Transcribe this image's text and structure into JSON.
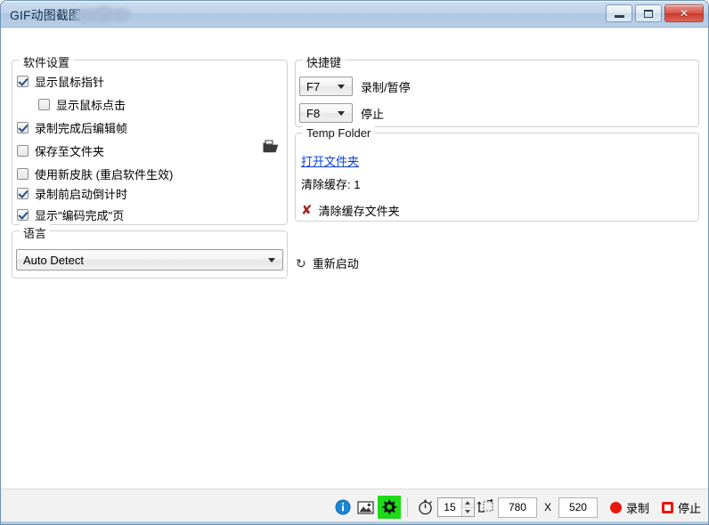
{
  "window": {
    "title": "GIF动图截图-",
    "controls": {
      "minimize": "—",
      "maximize": "□",
      "close": "✕"
    }
  },
  "software_settings": {
    "legend": "软件设置",
    "options": [
      {
        "label": "显示鼠标指针",
        "checked": true,
        "indent": false
      },
      {
        "label": "显示鼠标点击",
        "checked": false,
        "indent": true
      },
      {
        "label": "录制完成后编辑帧",
        "checked": true,
        "indent": false
      },
      {
        "label": "保存至文件夹",
        "checked": false,
        "indent": false
      },
      {
        "label": "使用新皮肤 (重启软件生效)",
        "checked": false,
        "indent": false
      },
      {
        "label": "录制前启动倒计时",
        "checked": true,
        "indent": false
      },
      {
        "label": "显示\"编码完成\"页",
        "checked": true,
        "indent": false
      }
    ],
    "browse_icon": "folder-icon"
  },
  "language": {
    "legend": "语言",
    "selected": "Auto Detect"
  },
  "hotkeys": {
    "legend": "快捷键",
    "rows": [
      {
        "key": "F7",
        "action": "录制/暂停"
      },
      {
        "key": "F8",
        "action": "停止"
      }
    ]
  },
  "temp_folder": {
    "legend": "Temp Folder",
    "open_link": "打开文件夹",
    "cache_label": "清除缓存: 1",
    "clear_action": "清除缓存文件夹",
    "clear_icon": "x-mark-icon"
  },
  "restart": {
    "label": "重新启动",
    "icon": "refresh-icon"
  },
  "statusbar": {
    "info_icon": "info-icon",
    "image_icon": "image-icon",
    "settings_icon": "gear-icon",
    "timer_icon": "stopwatch-icon",
    "fps_value": "15",
    "resize_icon": "resize-icon",
    "width_value": "780",
    "separator_x": "X",
    "height_value": "520",
    "record_label": "录制",
    "stop_label": "停止"
  },
  "colors": {
    "accent_green": "#1ddb16",
    "record_red": "#e8170f",
    "link_blue": "#0b41d4",
    "titlebar_blue": "#aec7e2"
  }
}
